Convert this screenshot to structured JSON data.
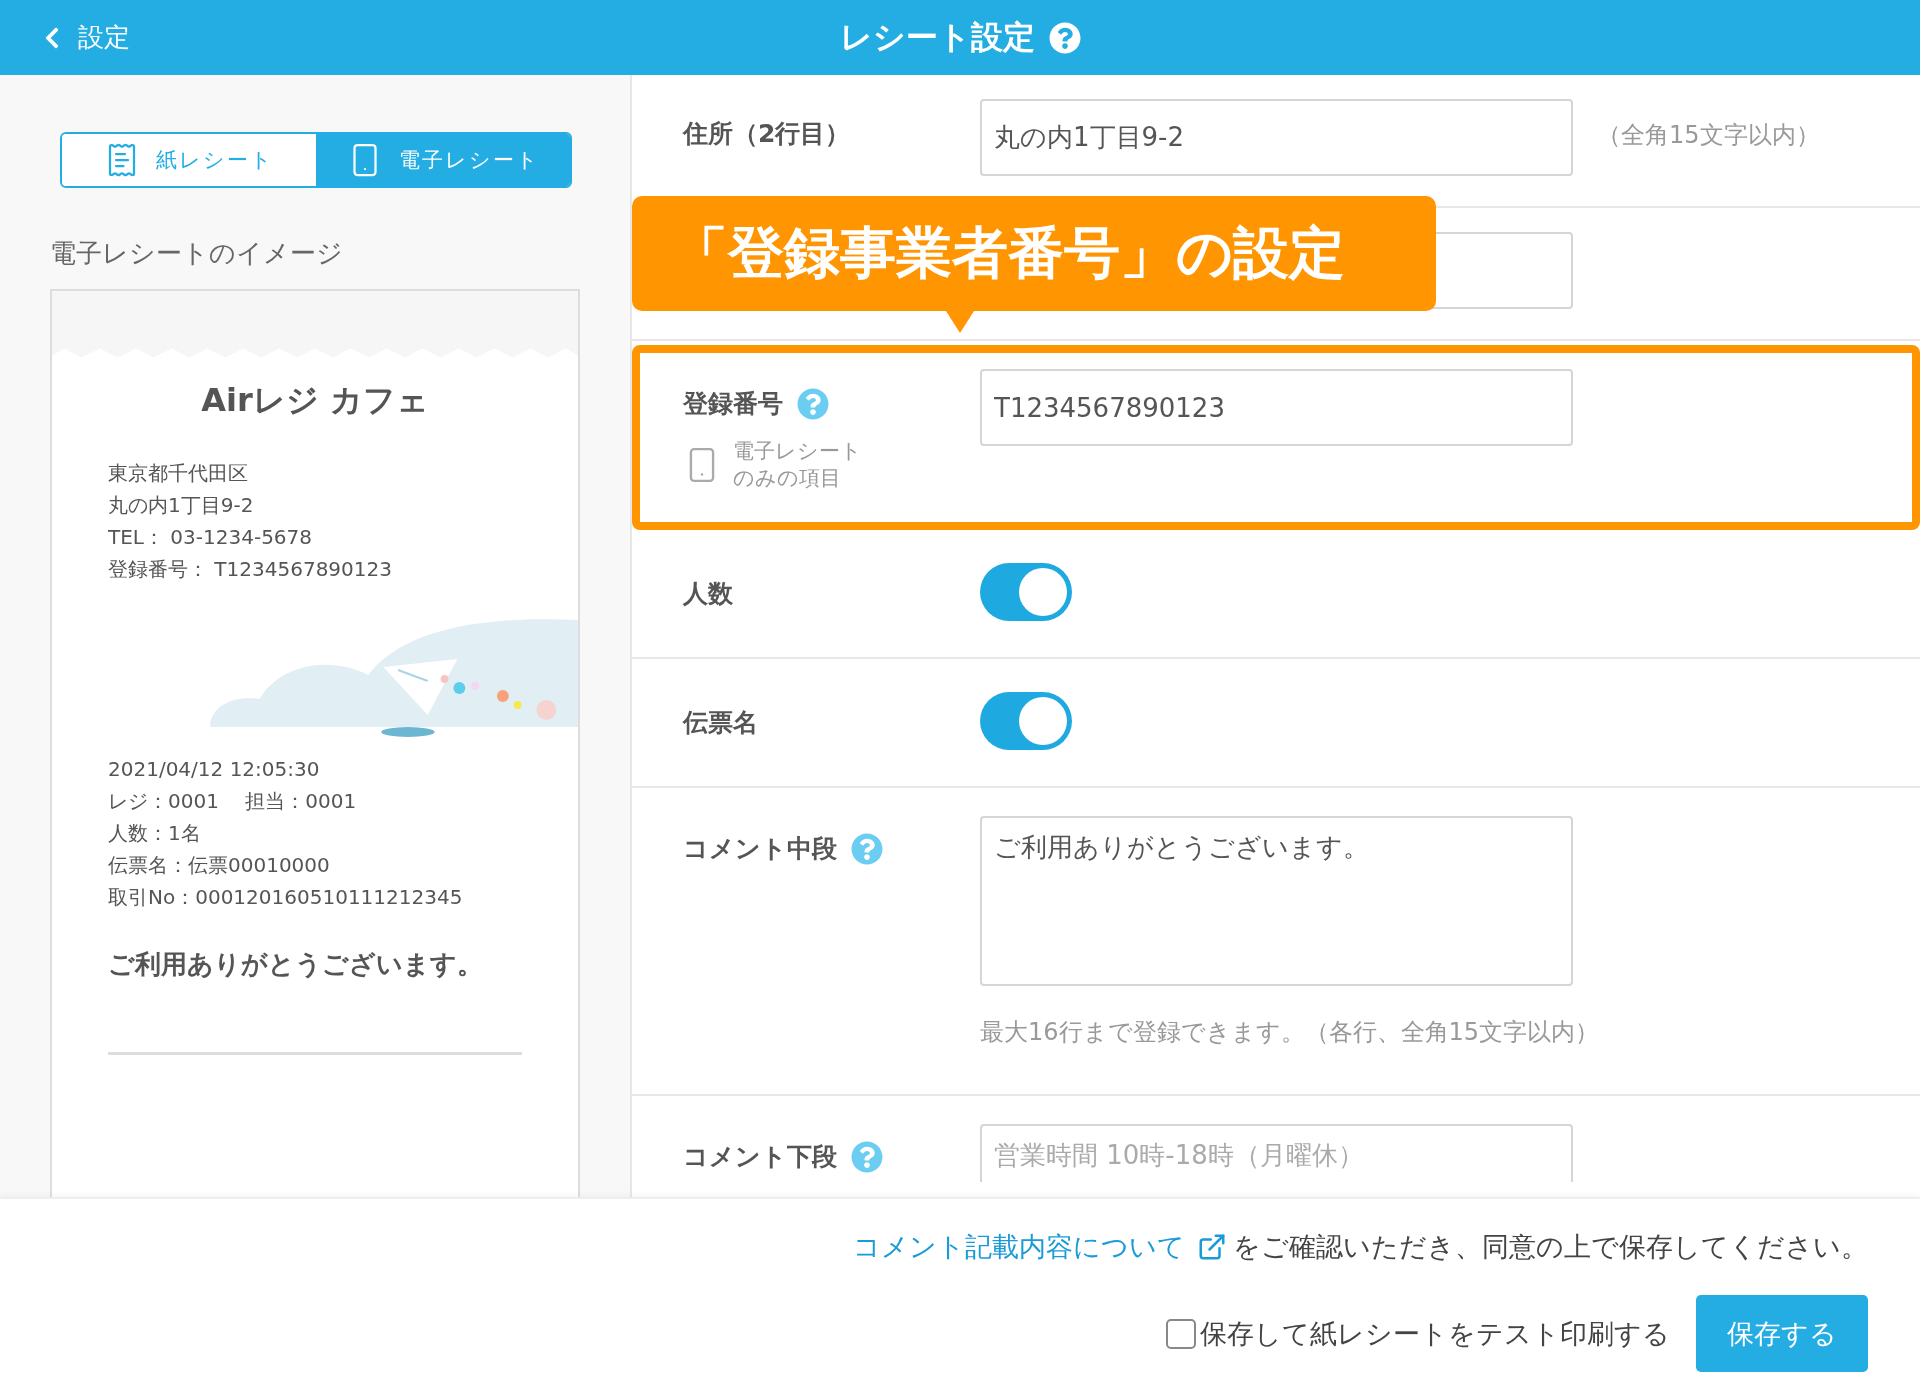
{
  "header": {
    "back_label": "設定",
    "title": "レシート設定",
    "help": true
  },
  "receipt_tabs": [
    {
      "label": "紙レシート",
      "kind": "paper",
      "selected": false
    },
    {
      "label": "電子レシート",
      "kind": "phone",
      "selected": true
    }
  ],
  "preview": {
    "title": "電子レシートのイメージ",
    "store_name": "Airレジ カフェ",
    "address_lines": [
      "東京都千代田区",
      "丸の内1丁目9-2",
      "TEL： 03-1234-5678",
      "登録番号： T1234567890123"
    ],
    "transaction_lines": [
      "2021/04/12 12:05:30",
      "レジ：0001　 担当：0001",
      "人数：1名",
      "伝票名：伝票00010000",
      "取引No：000120160510111212345"
    ],
    "thank_you": "ご利用ありがとうございます。"
  },
  "settings": [
    {
      "kind": "text",
      "label": "住所（2行目）",
      "value": "丸の内1丁目9-2",
      "note": "（全角15文字以内）"
    },
    {
      "kind": "text"
    },
    {
      "kind": "text",
      "label": "登録番号",
      "help": true,
      "value": "T1234567890123",
      "sub_note": "電子レシートのみの項目",
      "highlighted": true
    },
    {
      "kind": "toggle",
      "label": "人数",
      "on": true
    },
    {
      "kind": "toggle",
      "label": "伝票名",
      "on": true
    },
    {
      "kind": "textarea",
      "label": "コメント中段",
      "help": true,
      "value": "ご利用ありがとうございます。",
      "hint": "最大16行まで登録できます。（各行、全角15文字以内）"
    },
    {
      "kind": "textarea",
      "label": "コメント下段",
      "help": true,
      "placeholder": "営業時間 10時-18時（月曜休）"
    }
  ],
  "callout": {
    "text": "「登録事業者番号」の設定"
  },
  "footer": {
    "link": "コメント記載内容について",
    "notice": "をご確認いただき、同意の上で保存してください。",
    "print_checkbox": {
      "label": "保存して紙レシートをテスト印刷する",
      "checked": false
    },
    "save_button": "保存する"
  }
}
